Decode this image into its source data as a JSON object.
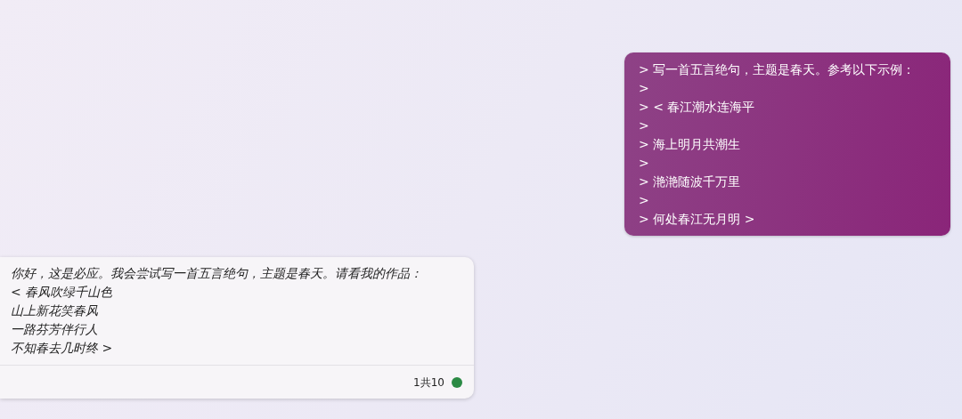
{
  "user_message": {
    "lines": [
      "> 写一首五言绝句，主题是春天。参考以下示例：",
      ">",
      "> < 春江潮水连海平",
      ">",
      "> 海上明月共潮生",
      ">",
      "> 滟滟随波千万里",
      ">",
      "> 何处春江无月明 >"
    ]
  },
  "bot_message": {
    "lines": [
      "你好，这是必应。我会尝试写一首五言绝句，主题是春天。请看我的作品：",
      "< 春风吹绿千山色",
      "山上新花笑春风",
      "一路芬芳伴行人",
      "不知春去几时终 >"
    ],
    "counter": "1共10"
  }
}
